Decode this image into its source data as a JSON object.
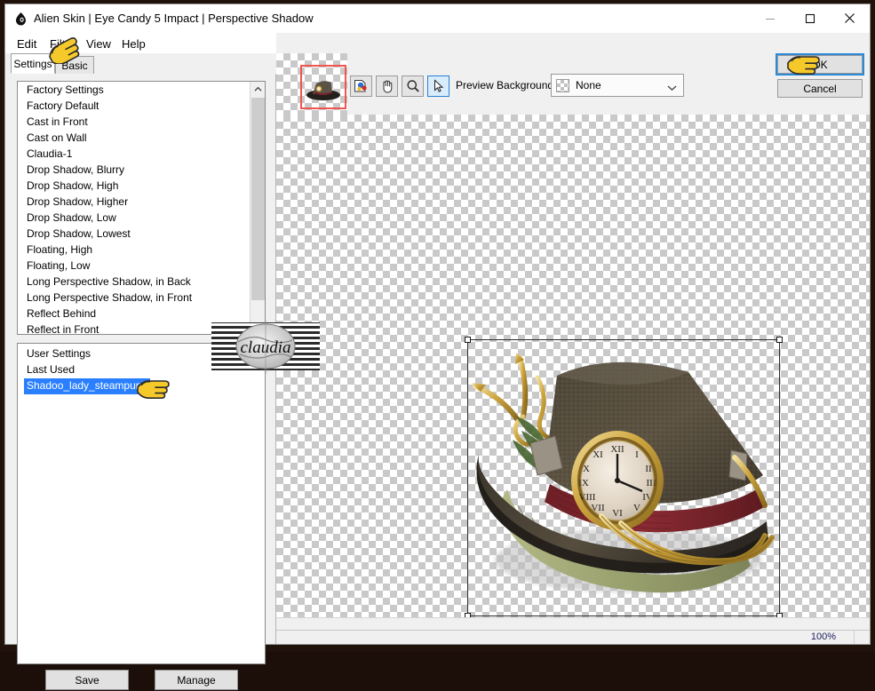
{
  "window": {
    "title": "Alien Skin | Eye Candy 5 Impact | Perspective Shadow",
    "app_icon": "eyecandy-drop-icon",
    "minimize_label": "—",
    "maximize_label": "□",
    "close_label": "✕"
  },
  "menubar": {
    "items": [
      {
        "label": "Edit",
        "name": "menu-edit"
      },
      {
        "label": "Filter",
        "name": "menu-filter"
      },
      {
        "label": "View",
        "name": "menu-view"
      },
      {
        "label": "Help",
        "name": "menu-help"
      }
    ]
  },
  "tabs": [
    {
      "label": "Settings",
      "active": true
    },
    {
      "label": "Basic",
      "active": false
    }
  ],
  "settings_list": {
    "group_label": "Factory Settings",
    "items": [
      "Factory Default",
      "Cast in Front",
      "Cast on Wall",
      "Claudia-1",
      "Drop Shadow, Blurry",
      "Drop Shadow, High",
      "Drop Shadow, Higher",
      "Drop Shadow, Low",
      "Drop Shadow, Lowest",
      "Floating, High",
      "Floating, Low",
      "Long Perspective Shadow, in Back",
      "Long Perspective Shadow, in Front",
      "Reflect Behind",
      "Reflect in Front"
    ]
  },
  "user_settings": {
    "group_label": "User Settings",
    "items": [
      {
        "label": "Last Used",
        "selected": false
      },
      {
        "label": "Shadoo_lady_steampunk",
        "selected": true
      }
    ],
    "selection_color": "#2a7fff"
  },
  "buttons": {
    "save": "Save",
    "manage": "Manage",
    "ok": "OK",
    "cancel": "Cancel"
  },
  "toolbar": {
    "tools": [
      {
        "name": "navigator-color-icon",
        "active": false
      },
      {
        "name": "hand-pan-icon",
        "active": false
      },
      {
        "name": "zoom-magnifier-icon",
        "active": false
      },
      {
        "name": "arrow-select-icon",
        "active": true
      }
    ],
    "preview_background_label": "Preview Background:",
    "preview_background_value": "None",
    "preview_background_swatch": "checkerboard",
    "navigator_rect_color": "#f0554f"
  },
  "statusbar": {
    "zoom": "100%"
  },
  "watermark": {
    "text": "claudia"
  },
  "canvas": {
    "background": "checkerboard",
    "subject": "steampunk-top-hat-with-clock"
  }
}
